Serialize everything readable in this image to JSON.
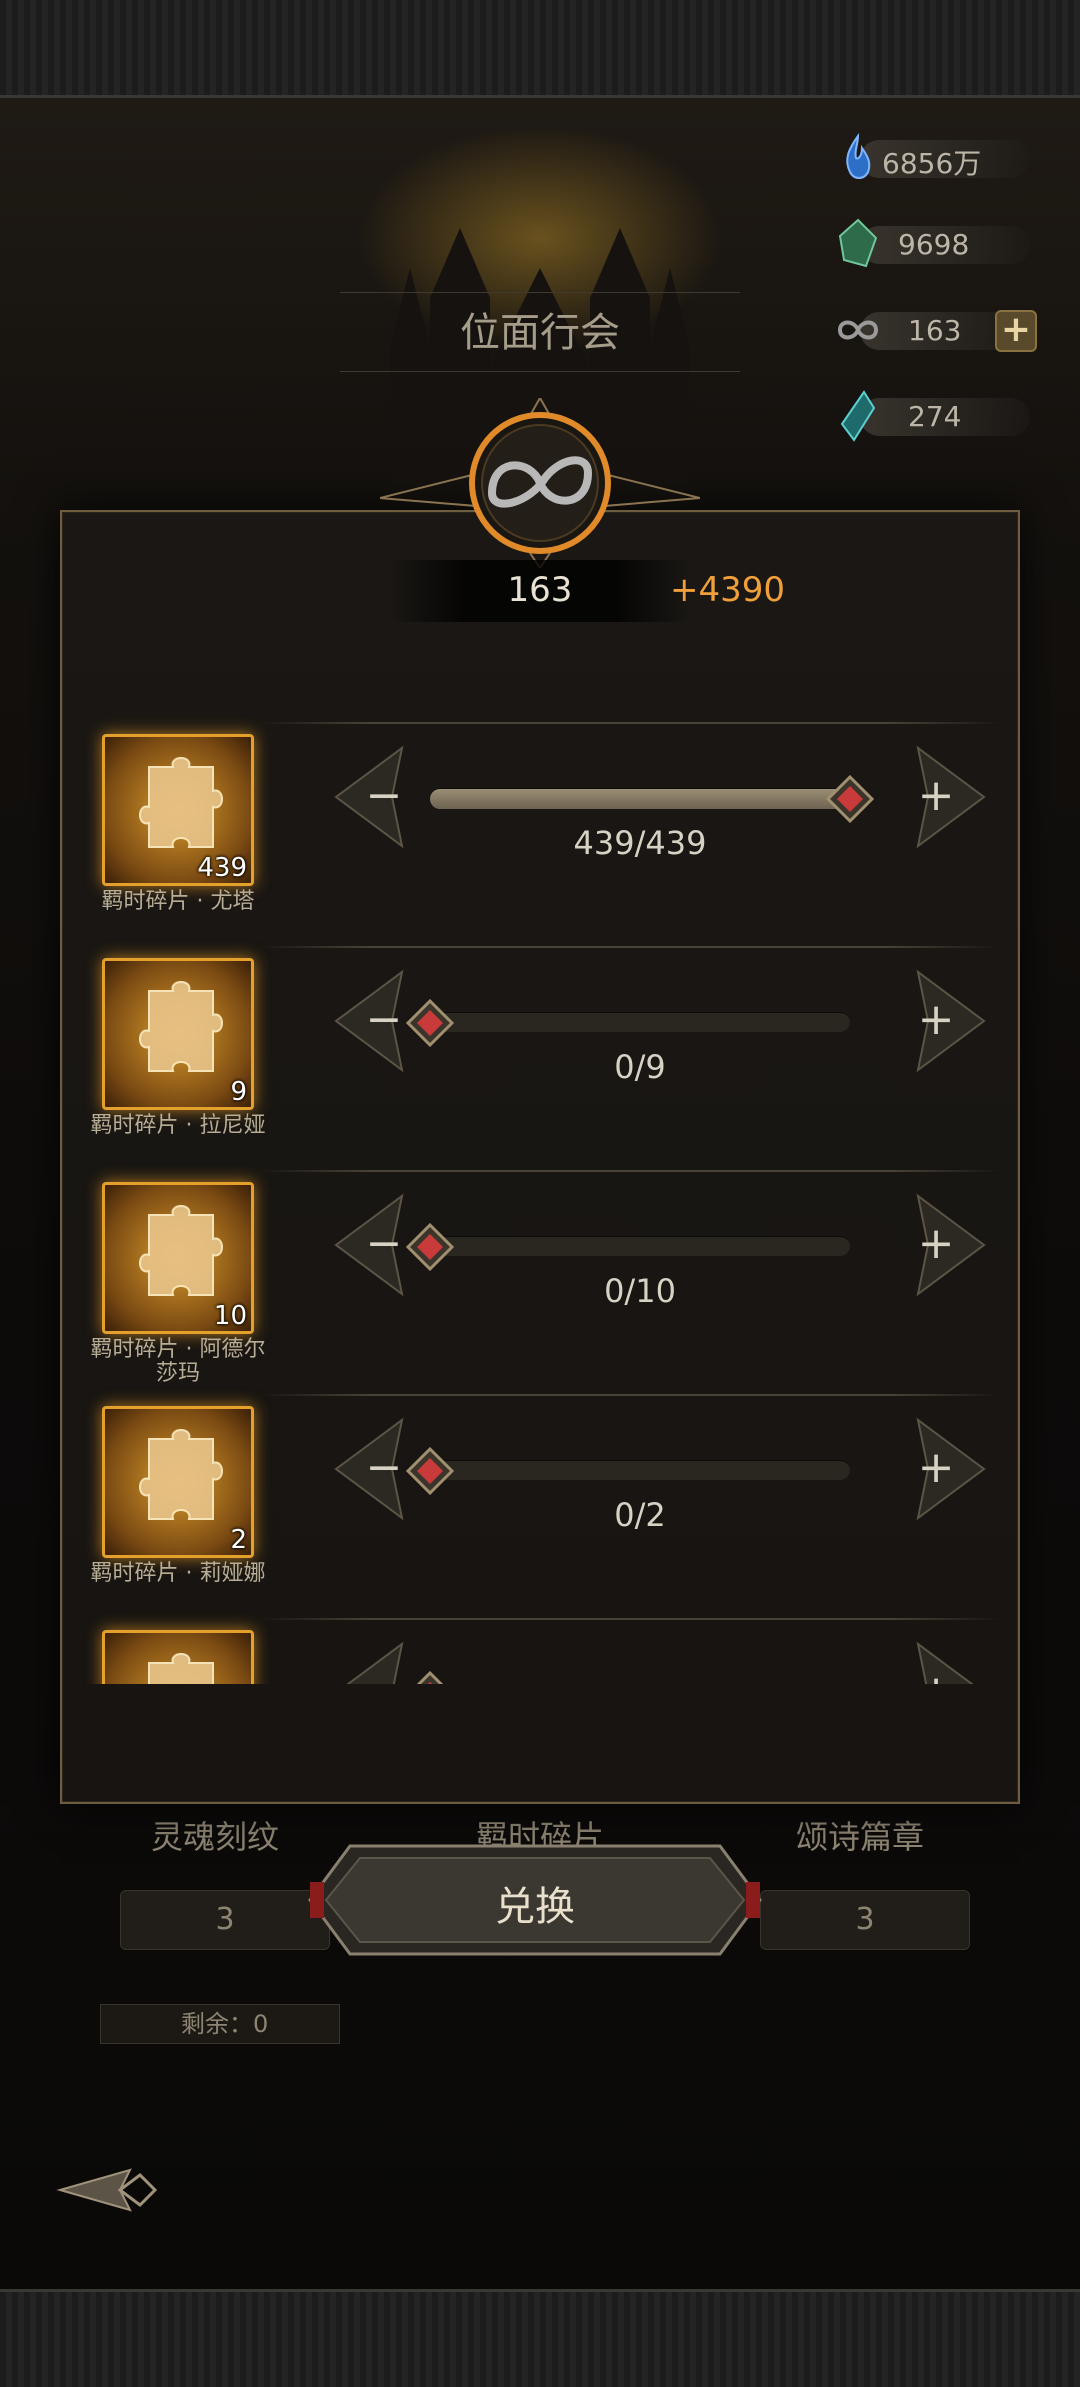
{
  "header": {
    "title": "位面行会"
  },
  "resources": [
    {
      "icon": "soul-flame-icon",
      "value": "6856万"
    },
    {
      "icon": "green-crystal-icon",
      "value": "9698"
    },
    {
      "icon": "infinity-serpent-icon",
      "value": "163"
    },
    {
      "icon": "teal-shard-icon",
      "value": "274"
    }
  ],
  "modal": {
    "current": "163",
    "gain": "+4390",
    "items": [
      {
        "name": "羁时碎片 · 尤塔",
        "qty": "439",
        "progress": "439/439",
        "selected": 439,
        "max": 439
      },
      {
        "name": "羁时碎片 · 拉尼娅",
        "qty": "9",
        "progress": "0/9",
        "selected": 0,
        "max": 9
      },
      {
        "name": "羁时碎片 · 阿德尔\n莎玛",
        "qty": "10",
        "progress": "0/10",
        "selected": 0,
        "max": 10
      },
      {
        "name": "羁时碎片 · 莉娅娜",
        "qty": "2",
        "progress": "0/2",
        "selected": 0,
        "max": 2
      },
      {
        "name": "",
        "qty": "",
        "progress": "",
        "selected": 0,
        "max": 1
      }
    ],
    "confirm_label": "兑换"
  },
  "background": {
    "tabs": [
      "灵魂刻纹",
      "羁时碎片",
      "颂诗篇章"
    ],
    "costs": [
      "3",
      "3"
    ],
    "remaining": "剩余：0"
  },
  "colors": {
    "accent": "#f0a03a",
    "frame_gold": "#6e5d3f",
    "item_glow": "#e3a02b"
  }
}
